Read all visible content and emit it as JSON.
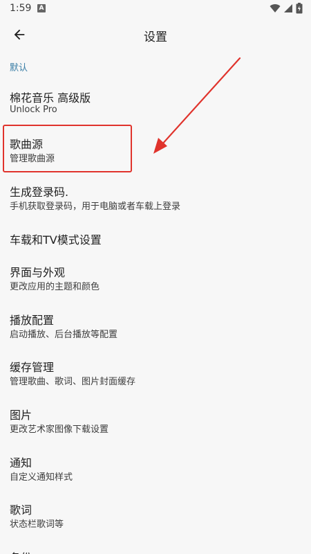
{
  "status_bar": {
    "time": "1:59",
    "notification_badge": "A",
    "icons": [
      "wifi-icon",
      "signal-icon",
      "battery-icon"
    ]
  },
  "app_bar": {
    "back_icon": "arrow-back-icon",
    "title": "设置"
  },
  "section": {
    "header": "默认"
  },
  "items": [
    {
      "title": "棉花音乐 高级版",
      "subtitle": "Unlock Pro"
    },
    {
      "title": "歌曲源",
      "subtitle": "管理歌曲源"
    },
    {
      "title": "生成登录码.",
      "subtitle": "手机获取登录码，用于电脑或者车载上登录"
    },
    {
      "title": "车载和TV模式设置",
      "subtitle": ""
    },
    {
      "title": "界面与外观",
      "subtitle": "更改应用的主题和颜色"
    },
    {
      "title": "播放配置",
      "subtitle": "启动播放、后台播放等配置"
    },
    {
      "title": "缓存管理",
      "subtitle": "管理歌曲、歌词、图片封面缓存"
    },
    {
      "title": "图片",
      "subtitle": "更改艺术家图像下载设置"
    },
    {
      "title": "通知",
      "subtitle": "自定义通知样式"
    },
    {
      "title": "歌词",
      "subtitle": "状态栏歌词等"
    },
    {
      "title": "备份",
      "subtitle": ""
    }
  ],
  "colors": {
    "background": "#f7f7f7",
    "section_header": "#3a7ea6",
    "annotation": "#e0332c"
  }
}
